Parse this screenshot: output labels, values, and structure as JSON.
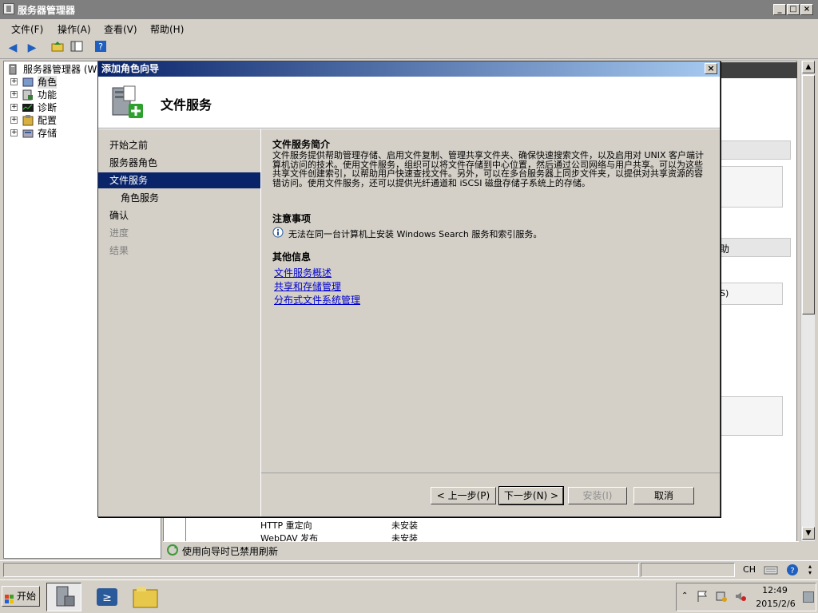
{
  "main_window": {
    "title": "服务器管理器"
  },
  "menu": {
    "items": [
      "文件(F)",
      "操作(A)",
      "查看(V)",
      "帮助(H)"
    ]
  },
  "tree": {
    "root": "服务器管理器 (W",
    "items": [
      "角色",
      "功能",
      "诊断",
      "配置",
      "存储"
    ]
  },
  "background": {
    "right_fragments": [
      "助",
      "S)"
    ],
    "table_rows": [
      {
        "name": "HTTP 重定向",
        "status": "未安装"
      },
      {
        "name": "WebDAV 发布",
        "status": "未安装"
      }
    ],
    "refresh_status": "使用向导时已禁用刷新"
  },
  "wizard": {
    "title": "添加角色向导",
    "header": "文件服务",
    "steps": [
      {
        "label": "开始之前",
        "state": "normal"
      },
      {
        "label": "服务器角色",
        "state": "normal"
      },
      {
        "label": "文件服务",
        "state": "active"
      },
      {
        "label": "角色服务",
        "state": "sub"
      },
      {
        "label": "确认",
        "state": "normal"
      },
      {
        "label": "进度",
        "state": "disabled"
      },
      {
        "label": "结果",
        "state": "disabled"
      }
    ],
    "intro_title": "文件服务简介",
    "intro_text": "文件服务提供帮助管理存储、启用文件复制、管理共享文件夹、确保快速搜索文件，以及启用对 UNIX 客户端计算机访问的技术。使用文件服务，组织可以将文件存储到中心位置，然后通过公司网络与用户共享。可以为这些共享文件创建索引，以帮助用户快速查找文件。另外，可以在多台服务器上同步文件夹，以提供对共享资源的容错访问。使用文件服务，还可以提供光纤通道和 iSCSI 磁盘存储子系统上的存储。",
    "notes_title": "注意事项",
    "note_text": "无法在同一台计算机上安装 Windows Search 服务和索引服务。",
    "more_title": "其他信息",
    "links": [
      "文件服务概述",
      "共享和存储管理",
      "分布式文件系统管理"
    ],
    "buttons": {
      "prev": "< 上一步(P)",
      "next": "下一步(N) >",
      "install": "安装(I)",
      "cancel": "取消"
    }
  },
  "statusbar": {
    "lang": "CH"
  },
  "taskbar": {
    "start": "开始",
    "time": "12:49",
    "date": "2015/2/6"
  },
  "colors": {
    "active_step": "#0a246a",
    "link": "#0000cc",
    "title_gradient_start": "#0a246a",
    "title_gradient_end": "#a6caf0"
  }
}
